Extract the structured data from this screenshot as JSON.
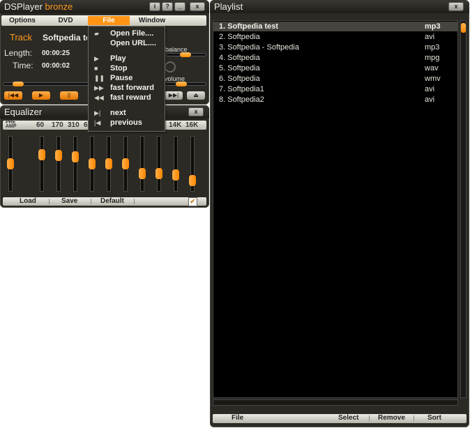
{
  "player": {
    "title_main": "DSPlayer",
    "title_accent": "bronze",
    "title_buttons": [
      "i",
      "?",
      "_",
      "x"
    ],
    "menu": [
      "Options",
      "DVD",
      "File",
      "Window"
    ],
    "track_label": "Track",
    "track_value": "Softpedia test",
    "length_label": "Length:",
    "length_value": "00:00:25",
    "time_label": "Time:",
    "time_value": "00:00:02",
    "balance_label": "balance",
    "volume_label": "volume",
    "controls": [
      "|◀◀",
      "▶",
      "||",
      "▶▶",
      "▶▶|",
      "⏏"
    ]
  },
  "file_menu": {
    "items": [
      {
        "label": "Open File....",
        "icon": "folder-icon"
      },
      {
        "label": "Open URL....",
        "icon": ""
      },
      {
        "label": "Play",
        "icon": "play-icon"
      },
      {
        "label": "Stop",
        "icon": "stop-icon"
      },
      {
        "label": "Pause",
        "icon": "pause-icon"
      },
      {
        "label": "fast forward",
        "icon": "fast-forward-icon"
      },
      {
        "label": "fast reward",
        "icon": "fast-rewind-icon"
      },
      {
        "label": "next",
        "icon": "next-icon"
      },
      {
        "label": "previous",
        "icon": "previous-icon"
      }
    ]
  },
  "equalizer": {
    "title": "Equalizer",
    "pre_label": "PRE",
    "amp_label": "AMP",
    "bands": [
      "60",
      "170",
      "310",
      "6",
      "14K",
      "16K"
    ],
    "slider_levels": [
      0.5,
      0.7,
      0.68,
      0.65,
      0.5,
      0.5,
      0.5,
      0.28,
      0.28,
      0.25,
      0.12
    ],
    "footer": [
      "Load",
      "Save",
      "Default"
    ]
  },
  "playlist": {
    "title": "Playlist",
    "close_label": "x",
    "selected_index": 0,
    "items": [
      {
        "name": "1. Softpedia test",
        "type": "mp3"
      },
      {
        "name": "2. Softpedia",
        "type": "avi"
      },
      {
        "name": "3. Softpedia - Softpedia",
        "type": "mp3"
      },
      {
        "name": "4. Softpedia",
        "type": "mpg"
      },
      {
        "name": "5. Softpedia",
        "type": "wav"
      },
      {
        "name": "6. Softpedia",
        "type": "wmv"
      },
      {
        "name": "7. Softpedia1",
        "type": "avi"
      },
      {
        "name": "8. Softpedia2",
        "type": "avi"
      }
    ],
    "footer": [
      "File",
      "Select",
      "Remove",
      "Sort"
    ]
  }
}
